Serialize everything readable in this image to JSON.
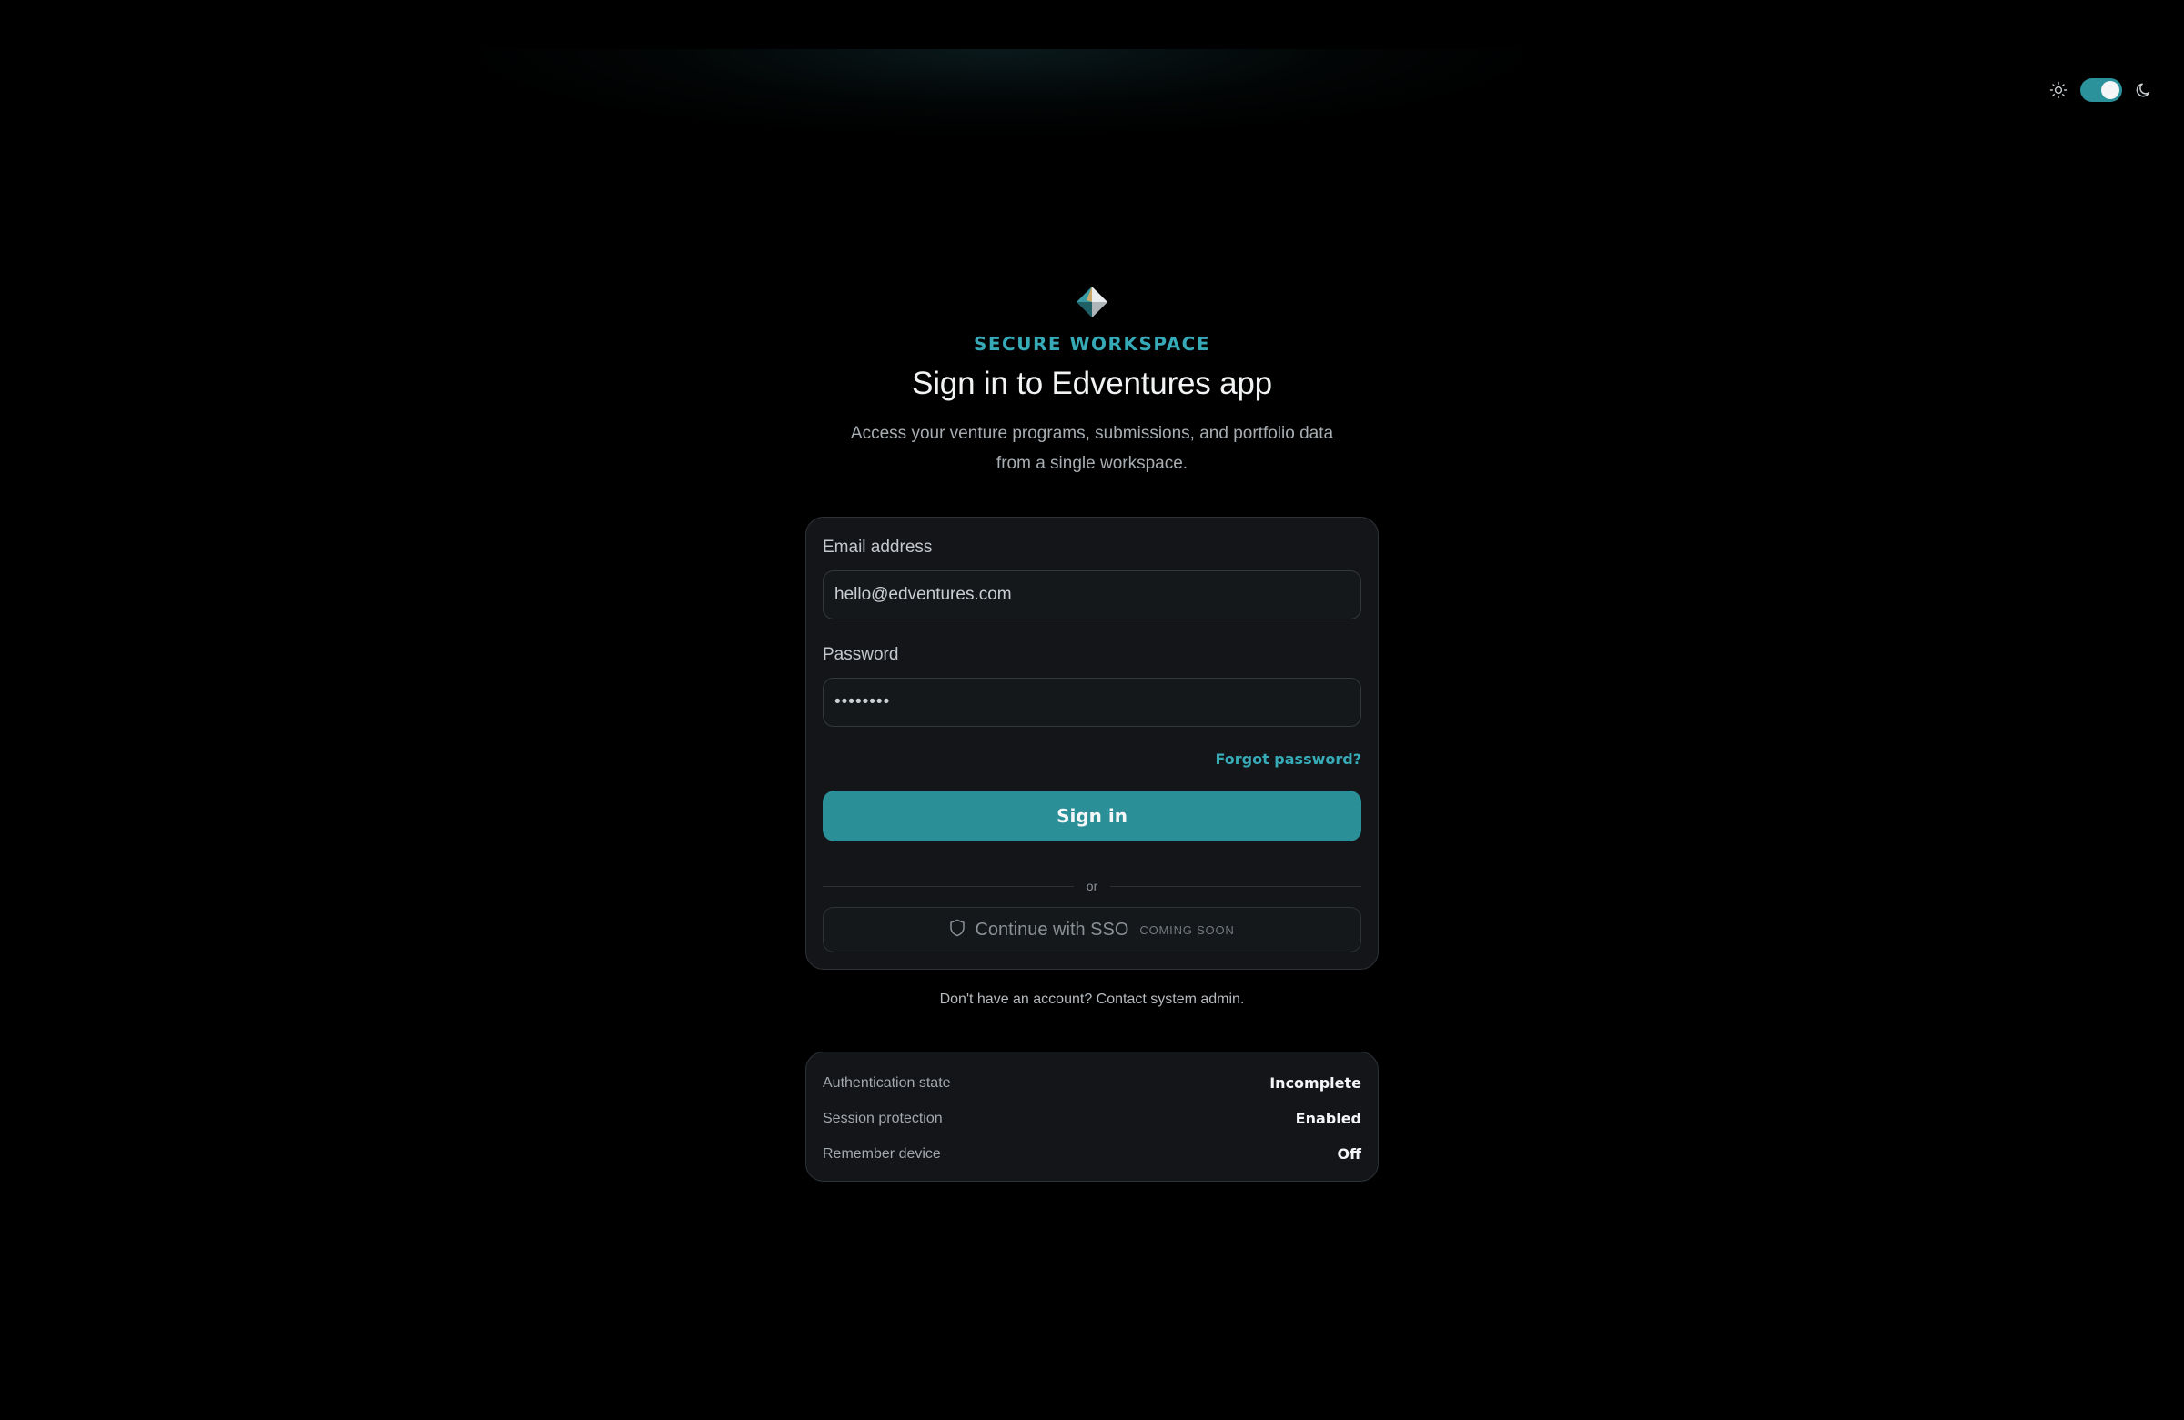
{
  "theme": {
    "accent": "#2b929b",
    "accent_text": "#36aab6",
    "background": "#000000",
    "card": "#131518",
    "toggle": {
      "light_icon": "sun-icon",
      "dark_icon": "moon-icon",
      "mode": "dark"
    }
  },
  "header": {
    "logo_icon": "diamond-logo-icon",
    "eyebrow": "SECURE WORKSPACE",
    "title": "Sign in to Edventures app",
    "subtitle": "Access your venture programs, submissions, and portfolio data from a single workspace."
  },
  "form": {
    "email_label": "Email address",
    "email_value": "hello@edventures.com",
    "password_label": "Password",
    "password_value": "••••••••",
    "forgot_label": "Forgot password?",
    "signin_label": "Sign in",
    "divider_label": "or",
    "sso_icon": "shield-icon",
    "sso_label": "Continue with SSO",
    "sso_badge": "COMING SOON"
  },
  "account_note": "Don't have an account? Contact system admin.",
  "status": [
    {
      "label": "Authentication state",
      "value": "Incomplete"
    },
    {
      "label": "Session protection",
      "value": "Enabled"
    },
    {
      "label": "Remember device",
      "value": "Off"
    }
  ]
}
